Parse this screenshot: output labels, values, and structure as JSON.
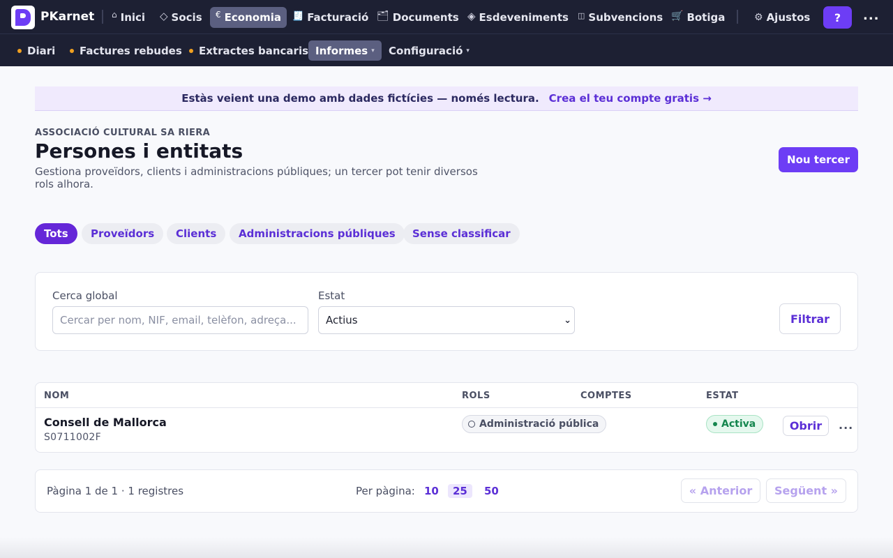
{
  "app": {
    "name": "PKarnet",
    "accent": "#6d3df5",
    "nav_bg": "#1d2033"
  },
  "topnav": {
    "items": [
      {
        "label": "Inici",
        "icon": "home-icon",
        "glyph": "⌂"
      },
      {
        "label": "Socis",
        "icon": "diamond-icon",
        "glyph": "◇"
      },
      {
        "label": "Economia",
        "icon": "euro-icon",
        "glyph": "€",
        "active": true
      },
      {
        "label": "Facturació",
        "icon": "receipt-icon",
        "glyph": "🧾"
      },
      {
        "label": "Documents",
        "icon": "folder-icon",
        "glyph": "🗂"
      },
      {
        "label": "Esdeveniments",
        "icon": "diamond-dot-icon",
        "glyph": "◈"
      },
      {
        "label": "Subvencions",
        "icon": "book-icon",
        "glyph": "◫"
      },
      {
        "label": "Botiga",
        "icon": "cart-icon",
        "glyph": "🛒"
      }
    ],
    "settings": {
      "label": "Ajustos",
      "glyph": "⚙"
    },
    "help": "?",
    "more": "..."
  },
  "subnav": {
    "items": [
      {
        "label": "Diari",
        "dot": true
      },
      {
        "label": "Factures rebudes",
        "dot": true
      },
      {
        "label": "Extractes bancaris",
        "dot": true
      },
      {
        "label": "Informes",
        "caret": "▾",
        "active": true
      },
      {
        "label": "Configuració",
        "caret": "▾"
      }
    ]
  },
  "banner": {
    "text": "Estàs veient una demo amb dades fictícies — només lectura.",
    "link": "Crea el teu compte gratis →"
  },
  "header": {
    "org": "ASSOCIACIÓ CULTURAL SA RIERA",
    "title": "Persones i entitats",
    "subtitle": "Gestiona proveïdors, clients i administracions públiques; un tercer pot tenir diversos rols alhora.",
    "new_button": "Nou tercer"
  },
  "tabs": [
    "Tots",
    "Proveïdors",
    "Clients",
    "Administracions públiques",
    "Sense classificar"
  ],
  "filters": {
    "search_label": "Cerca global",
    "search_placeholder": "Cercar per nom, NIF, email, telèfon, adreça...",
    "status_label": "Estat",
    "status_value": "Actius",
    "filter_button": "Filtrar"
  },
  "table": {
    "headers": {
      "name": "NOM",
      "roles": "ROLS",
      "accounts": "COMPTES",
      "status": "ESTAT"
    },
    "rows": [
      {
        "name": "Consell de Mallorca",
        "nif": "S0711002F",
        "role": "Administració pública",
        "status": "Activa",
        "open": "Obrir",
        "more": "..."
      }
    ]
  },
  "pagination": {
    "info": "Pàgina 1 de 1 · 1 registres",
    "per_page_label": "Per pàgina:",
    "sizes": [
      "10",
      "25",
      "50"
    ],
    "active_size": "25",
    "prev": "« Anterior",
    "next": "Següent »"
  }
}
